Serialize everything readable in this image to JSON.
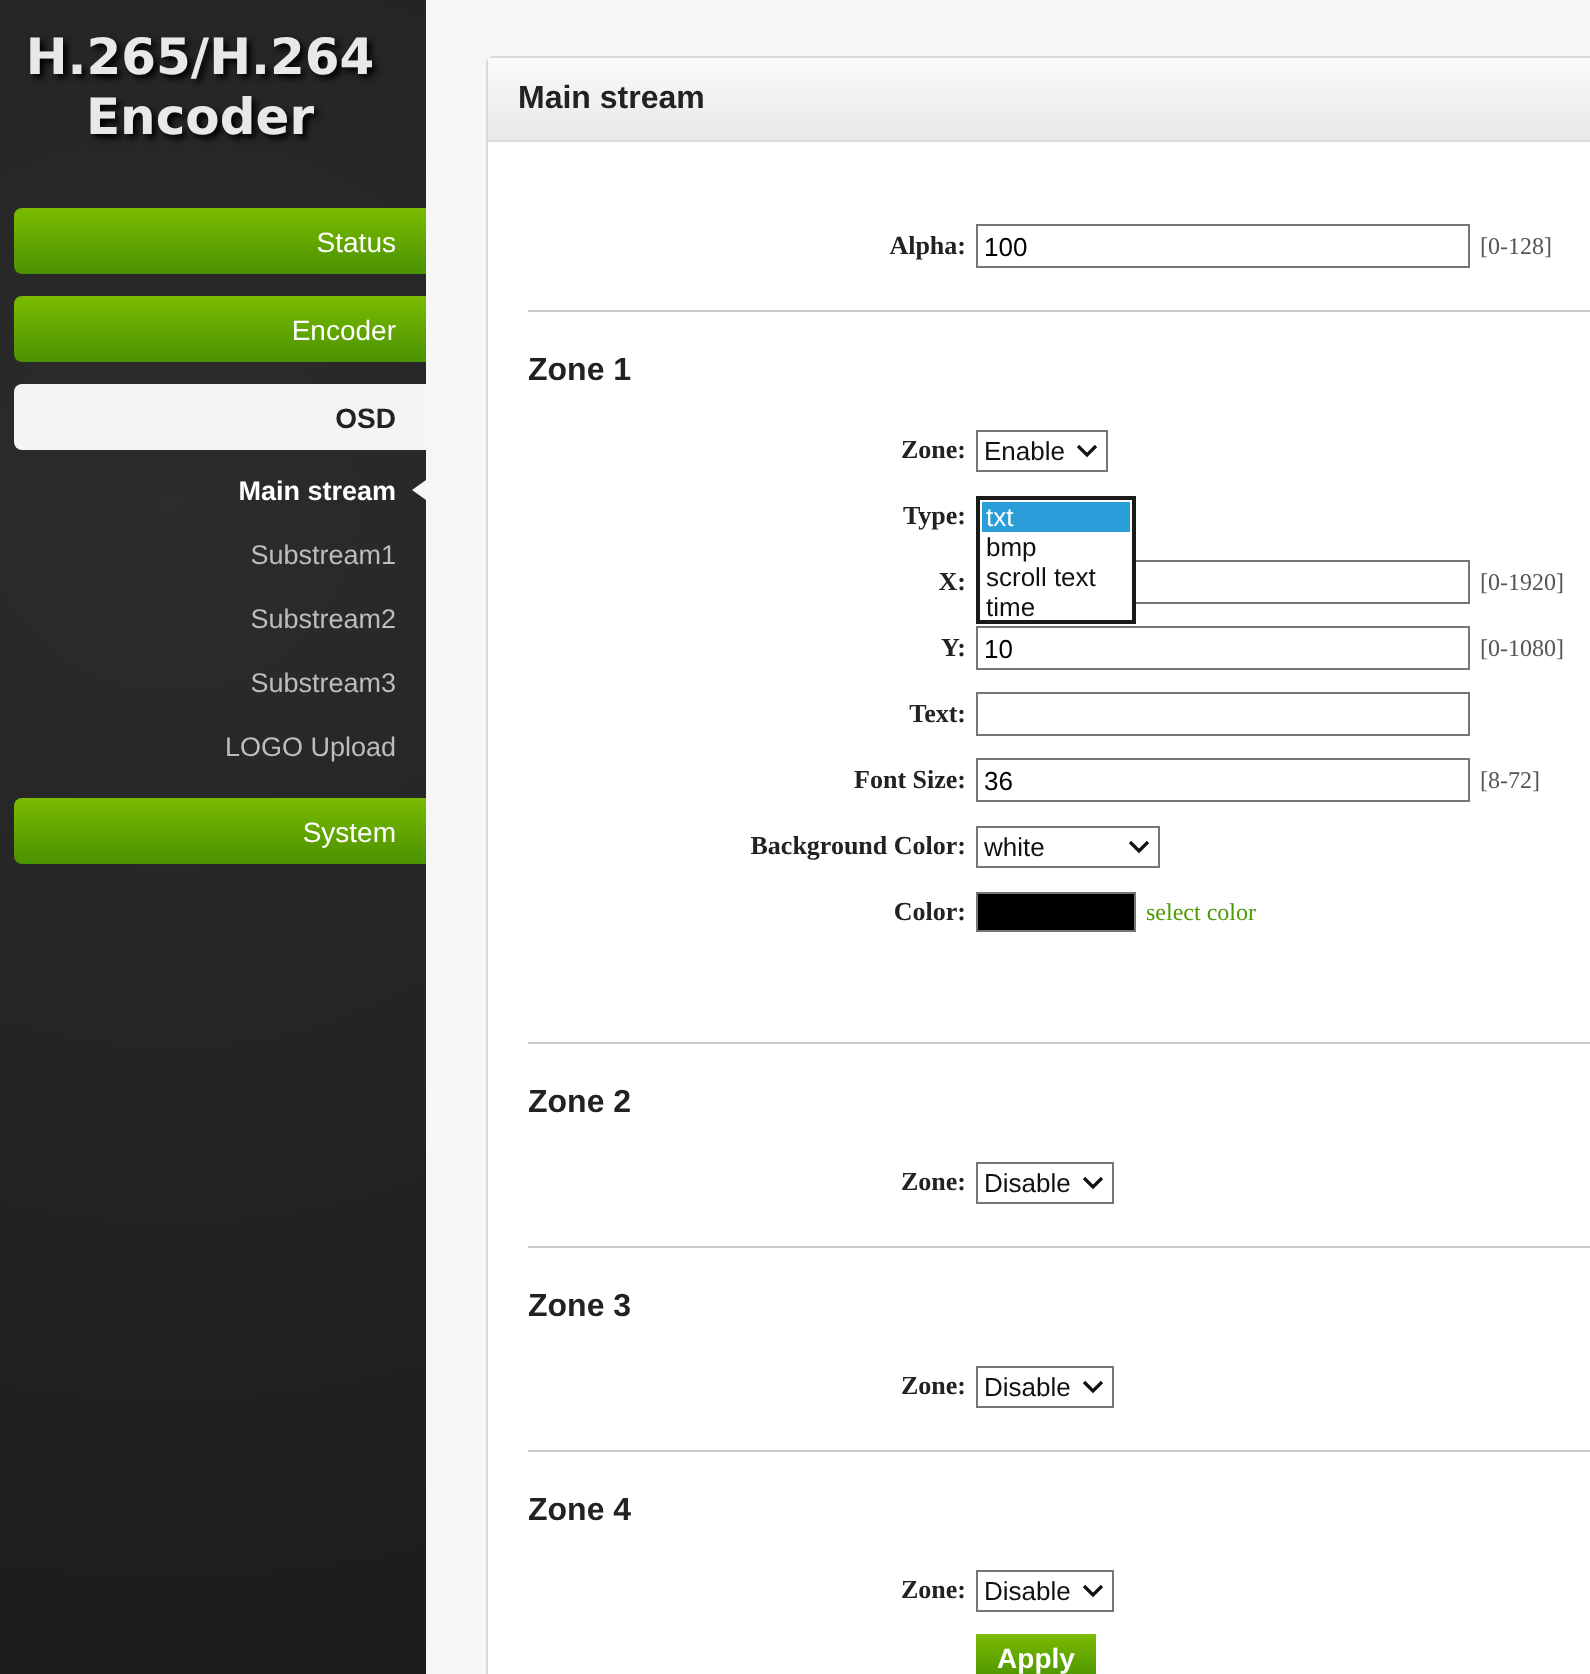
{
  "logo": {
    "lines": [
      "H.265/H.264",
      "Encoder"
    ]
  },
  "sidebar": {
    "items": [
      {
        "label": "Status",
        "selected": false
      },
      {
        "label": "Encoder",
        "selected": false
      },
      {
        "label": "OSD",
        "selected": true,
        "children": [
          {
            "label": "Main stream",
            "selected": true
          },
          {
            "label": "Substream1",
            "selected": false
          },
          {
            "label": "Substream2",
            "selected": false
          },
          {
            "label": "Substream3",
            "selected": false
          },
          {
            "label": "LOGO Upload",
            "selected": false
          }
        ]
      },
      {
        "label": "System",
        "selected": false
      }
    ]
  },
  "panel": {
    "title": "Main stream",
    "sections": [
      {
        "fields": [
          {
            "kind": "input",
            "label": "Alpha:",
            "value": "100",
            "range": "[0-128]"
          }
        ]
      },
      {
        "heading": "Zone 1",
        "fields": [
          {
            "kind": "select",
            "label": "Zone:",
            "value": "Enable"
          },
          {
            "kind": "listbox",
            "label": "Type:",
            "options": [
              {
                "label": "txt",
                "selected": true
              },
              {
                "label": "bmp",
                "selected": false
              },
              {
                "label": "scroll text",
                "selected": false
              },
              {
                "label": "time",
                "selected": false
              }
            ]
          },
          {
            "kind": "input",
            "label": "X:",
            "range": "[0-1920]"
          },
          {
            "kind": "input",
            "label": "Y:",
            "value": "10",
            "range": "[0-1080]"
          },
          {
            "kind": "input",
            "label": "Text:"
          },
          {
            "kind": "input",
            "label": "Font Size:",
            "value": "36",
            "range": "[8-72]"
          },
          {
            "kind": "select",
            "label": "Background Color:",
            "value": "white"
          },
          {
            "kind": "color",
            "label": "Color:",
            "color": "#000000",
            "link": "select color"
          }
        ]
      },
      {
        "heading": "Zone 2",
        "fields": [
          {
            "kind": "select",
            "label": "Zone:",
            "value": "Disable"
          }
        ]
      },
      {
        "heading": "Zone 3",
        "fields": [
          {
            "kind": "select",
            "label": "Zone:",
            "value": "Disable"
          }
        ]
      },
      {
        "heading": "Zone 4",
        "fields": [
          {
            "kind": "select",
            "label": "Zone:",
            "value": "Disable"
          }
        ]
      }
    ],
    "apply": "Apply"
  }
}
